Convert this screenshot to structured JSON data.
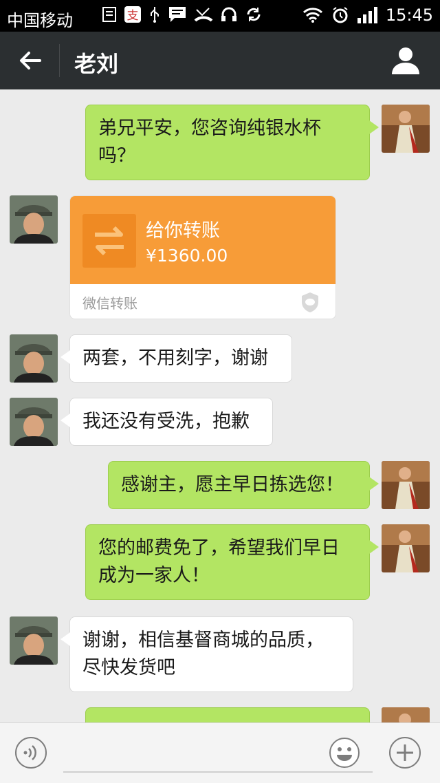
{
  "status_bar": {
    "carrier": "中国移动",
    "time": "15:45",
    "icons": [
      "sim-icon",
      "alipay-icon",
      "usb-icon",
      "message-icon",
      "missed-call-icon",
      "headset-icon",
      "sync-icon",
      "wifi-icon",
      "alarm-icon",
      "signal-icon"
    ]
  },
  "title_bar": {
    "title": "老刘",
    "back_icon": "back-arrow-icon",
    "profile_icon": "person-icon",
    "background": "#2b2f31"
  },
  "messages": [
    {
      "side": "right",
      "text": "弟兄平安，您咨询纯银水杯吗？"
    },
    {
      "side": "left",
      "type": "transfer",
      "title": "给你转账",
      "amount": "¥1360.00",
      "footer": "微信转账"
    },
    {
      "side": "left",
      "text": "两套，不用刻字，谢谢"
    },
    {
      "side": "left",
      "text": "我还没有受洗，抱歉"
    },
    {
      "side": "right",
      "text": "感谢主，愿主早日拣选您！"
    },
    {
      "side": "right",
      "text": "您的邮费免了，希望我们早日成为一家人！"
    },
    {
      "side": "left",
      "text": "谢谢，相信基督商城的品质，尽快发货吧"
    },
    {
      "side": "right",
      "text": ""
    }
  ],
  "input_bar": {
    "voice_icon": "voice-icon",
    "emoji_icon": "emoji-icon",
    "plus_icon": "plus-icon"
  },
  "colors": {
    "sent_bubble": "#b3e563",
    "received_bubble": "#ffffff",
    "transfer_card": "#f79c38",
    "chat_background": "#ebebeb"
  }
}
